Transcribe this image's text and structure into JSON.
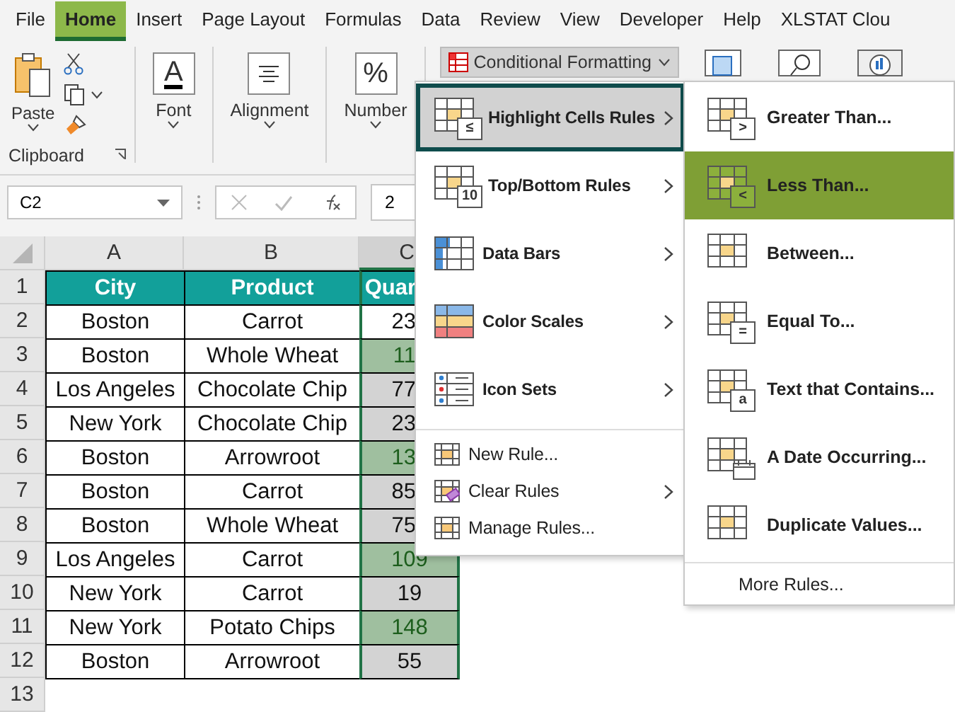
{
  "menu_tabs": [
    {
      "label": "File",
      "selected": false
    },
    {
      "label": "Home",
      "selected": true
    },
    {
      "label": "Insert",
      "selected": false
    },
    {
      "label": "Page Layout",
      "selected": false
    },
    {
      "label": "Formulas",
      "selected": false
    },
    {
      "label": "Data",
      "selected": false
    },
    {
      "label": "Review",
      "selected": false
    },
    {
      "label": "View",
      "selected": false
    },
    {
      "label": "Developer",
      "selected": false
    },
    {
      "label": "Help",
      "selected": false
    },
    {
      "label": "XLSTAT Clou",
      "selected": false
    }
  ],
  "ribbon": {
    "paste_label": "Paste",
    "clipboard_label": "Clipboard",
    "groups": [
      {
        "label": "Font",
        "glyph": "A",
        "kind": "font"
      },
      {
        "label": "Alignment",
        "kind": "align"
      },
      {
        "label": "Number",
        "glyph": "%",
        "kind": "number"
      }
    ],
    "conditional_formatting": {
      "label": "Conditional Formatting",
      "expanded": true
    }
  },
  "formula_bar": {
    "name_box": "C2",
    "formula": "2"
  },
  "columns": [
    "A",
    "B",
    "C"
  ],
  "header_row": {
    "number": "1",
    "cells": [
      "City",
      "Product",
      "Quar"
    ]
  },
  "rows": [
    {
      "number": "2",
      "city": "Boston",
      "product": "Carrot",
      "quantity": "23",
      "highlighted": false,
      "active": true
    },
    {
      "number": "3",
      "city": "Boston",
      "product": "Whole Wheat",
      "quantity": "11",
      "highlighted": true,
      "active": false
    },
    {
      "number": "4",
      "city": "Los Angeles",
      "product": "Chocolate Chip",
      "quantity": "77",
      "highlighted": false,
      "active": false
    },
    {
      "number": "5",
      "city": "New York",
      "product": "Chocolate Chip",
      "quantity": "23",
      "highlighted": false,
      "active": false
    },
    {
      "number": "6",
      "city": "Boston",
      "product": "Arrowroot",
      "quantity": "13",
      "highlighted": true,
      "active": false
    },
    {
      "number": "7",
      "city": "Boston",
      "product": "Carrot",
      "quantity": "85",
      "highlighted": false,
      "active": false
    },
    {
      "number": "8",
      "city": "Boston",
      "product": "Whole Wheat",
      "quantity": "75",
      "highlighted": false,
      "active": false
    },
    {
      "number": "9",
      "city": "Los Angeles",
      "product": "Carrot",
      "quantity": "109",
      "highlighted": true,
      "active": false
    },
    {
      "number": "10",
      "city": "New York",
      "product": "Carrot",
      "quantity": "19",
      "highlighted": false,
      "active": false
    },
    {
      "number": "11",
      "city": "New York",
      "product": "Potato Chips",
      "quantity": "148",
      "highlighted": true,
      "active": false
    },
    {
      "number": "12",
      "city": "Boston",
      "product": "Arrowroot",
      "quantity": "55",
      "highlighted": false,
      "active": false
    }
  ],
  "empty_row_number": "13",
  "menu": {
    "items": [
      {
        "label": "Highlight Cells Rules",
        "kind": "large",
        "badge": "≤",
        "submenu": true,
        "selected": true
      },
      {
        "label": "Top/Bottom Rules",
        "kind": "large",
        "badge": "10",
        "submenu": true,
        "selected": false
      },
      {
        "label": "Data Bars",
        "kind": "large",
        "submenu": true,
        "selected": false
      },
      {
        "label": "Color Scales",
        "kind": "large",
        "submenu": true,
        "selected": false
      },
      {
        "label": "Icon Sets",
        "kind": "large",
        "submenu": true,
        "selected": false
      },
      {
        "label": "New Rule...",
        "kind": "small",
        "submenu": false,
        "selected": false
      },
      {
        "label": "Clear Rules",
        "kind": "small",
        "submenu": true,
        "selected": false
      },
      {
        "label": "Manage Rules...",
        "kind": "small",
        "submenu": false,
        "selected": false
      }
    ]
  },
  "submenu": {
    "items": [
      {
        "label": "Greater Than...",
        "badge": ">",
        "selected": false
      },
      {
        "label": "Less Than...",
        "badge": "<",
        "selected": true
      },
      {
        "label": "Between...",
        "selected": false
      },
      {
        "label": "Equal To...",
        "badge": "=",
        "selected": false
      },
      {
        "label": "Text that Contains...",
        "badge": "a",
        "selected": false
      },
      {
        "label": "A Date Occurring...",
        "selected": false
      },
      {
        "label": "Duplicate Values...",
        "selected": false
      }
    ],
    "more": "More Rules..."
  }
}
